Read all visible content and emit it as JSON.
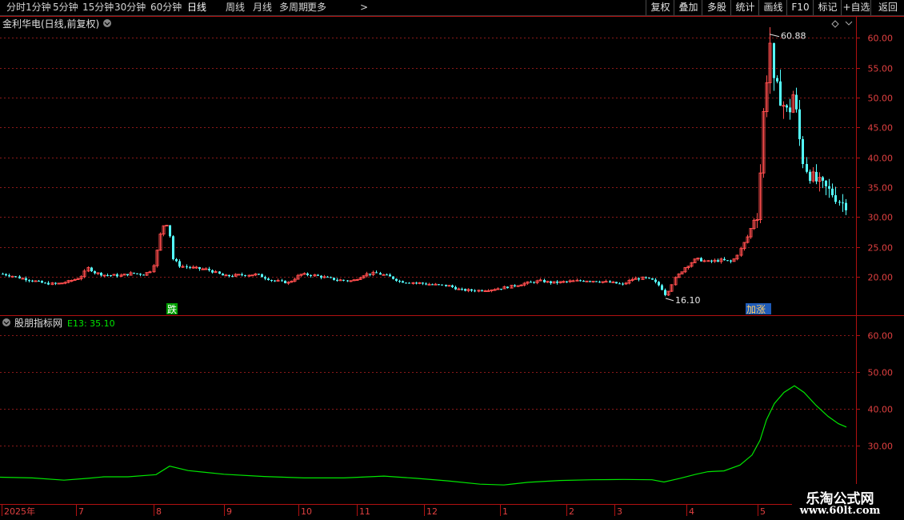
{
  "toolbar": {
    "periods": [
      "分时",
      "1分钟",
      "5分钟",
      "15分钟",
      "30分钟",
      "60分钟",
      "日线",
      "周线",
      "月线",
      "多周期",
      "更多"
    ],
    "active_period": "日线",
    "actions": [
      "复权",
      "叠加",
      "多股",
      "统计",
      "画线",
      "F10",
      "标记",
      "+自选",
      "返回"
    ]
  },
  "main_panel": {
    "title": "金利华电(日线,前复权)",
    "max_label": "60.88",
    "min_label": "16.10",
    "signal_down": "跌",
    "signal_up": "加涨",
    "y_ticks": [
      "60.00",
      "55.00",
      "50.00",
      "45.00",
      "40.00",
      "35.00",
      "30.00",
      "25.00",
      "20.00"
    ]
  },
  "indicator_panel": {
    "title": "股朋指标网",
    "value_text": "E13: 35.10",
    "y_ticks": [
      "60.00",
      "50.00",
      "40.00",
      "30.00"
    ]
  },
  "x_axis": {
    "labels": [
      "2025年",
      "7",
      "8",
      "9",
      "10",
      "11",
      "12",
      "1",
      "2",
      "3",
      "4",
      "5"
    ]
  },
  "watermark": {
    "title": "乐淘公式网",
    "url": "www.60lt.com"
  },
  "colors": {
    "up": "#ff4d4d",
    "down": "#54ffff",
    "ma_line": "#00e600",
    "grid": "#8a1a1a",
    "axis": "#b01010",
    "tick_text": "#e04040",
    "signal_down_bg": "#00a000",
    "signal_up_bg": "#1e5bb8"
  },
  "chart_data": {
    "type": "candlestick",
    "series": [
      {
        "name": "金利华电",
        "ohlc": []
      },
      {
        "name": "E13",
        "values": []
      }
    ]
  }
}
